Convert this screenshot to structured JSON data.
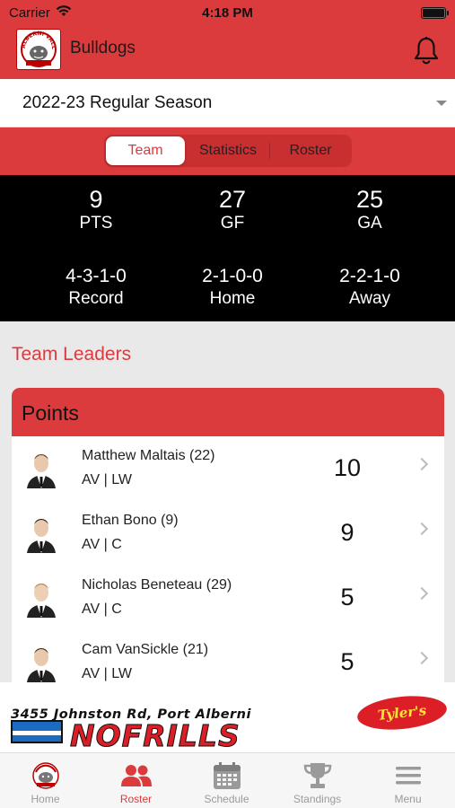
{
  "status": {
    "carrier": "Carrier",
    "time": "4:18 PM"
  },
  "header": {
    "title": "Bulldogs",
    "logo": "ALBERNI VALLEY BULLDOGS"
  },
  "season": {
    "selected": "2022-23 Regular Season"
  },
  "tabs": [
    {
      "label": "Team",
      "active": true
    },
    {
      "label": "Statistics",
      "active": false
    },
    {
      "label": "Roster",
      "active": false
    }
  ],
  "stats": {
    "pts": {
      "value": "9",
      "label": "PTS"
    },
    "gf": {
      "value": "27",
      "label": "GF"
    },
    "ga": {
      "value": "25",
      "label": "GA"
    },
    "record": {
      "value": "4-3-1-0",
      "label": "Record"
    },
    "home": {
      "value": "2-1-0-0",
      "label": "Home"
    },
    "away": {
      "value": "2-2-1-0",
      "label": "Away"
    }
  },
  "leaders": {
    "title": "Team Leaders",
    "card_title": "Points",
    "players": [
      {
        "name": "Matthew Maltais (22)",
        "pos": "AV | LW",
        "value": "10"
      },
      {
        "name": "Ethan Bono (9)",
        "pos": "AV | C",
        "value": "9"
      },
      {
        "name": "Nicholas Beneteau (29)",
        "pos": "AV | C",
        "value": "5"
      },
      {
        "name": "Cam VanSickle (21)",
        "pos": "AV | LW",
        "value": "5"
      }
    ]
  },
  "ad": {
    "address": "3455 Johnston Rd, Port Alberni",
    "brand": "NOFRILLS",
    "badge": "Tyler's"
  },
  "tabbar": [
    {
      "label": "Home",
      "icon": "bulldogs-logo-icon",
      "active": false
    },
    {
      "label": "Roster",
      "icon": "people-icon",
      "active": true
    },
    {
      "label": "Schedule",
      "icon": "calendar-icon",
      "active": false
    },
    {
      "label": "Standings",
      "icon": "trophy-icon",
      "active": false
    },
    {
      "label": "Menu",
      "icon": "hamburger-icon",
      "active": false
    }
  ],
  "colors": {
    "accent": "#dc3b3d",
    "stats_bg": "#000000"
  }
}
